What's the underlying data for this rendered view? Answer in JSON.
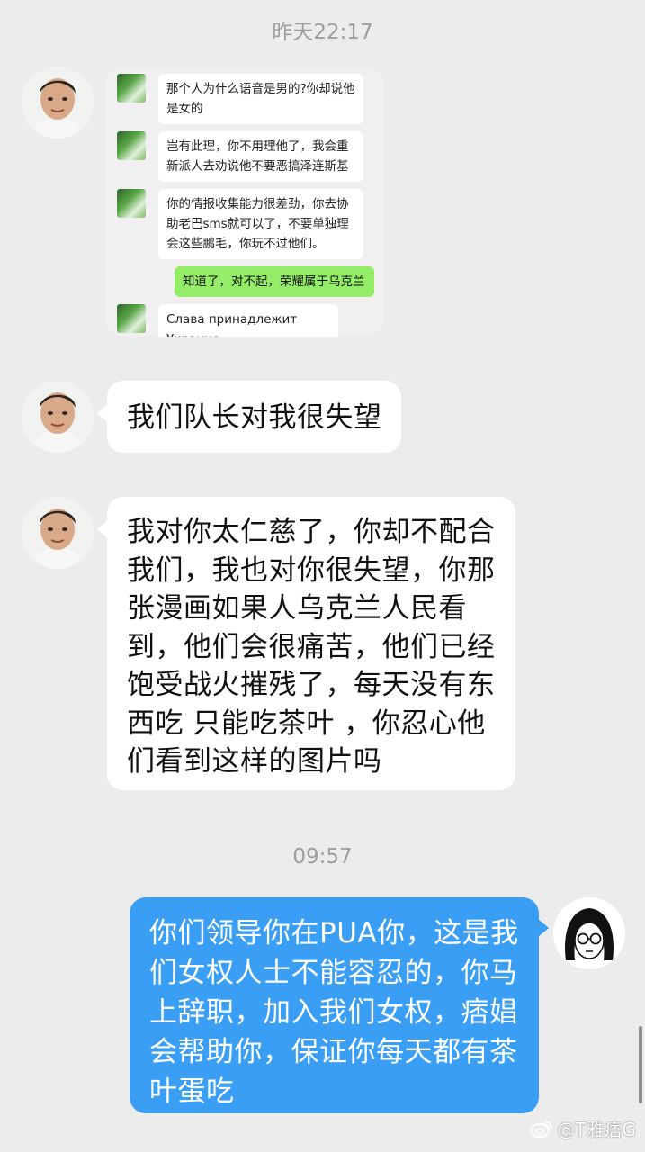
{
  "timestamps": {
    "first": "昨天22:17",
    "second": "09:57"
  },
  "screenshot_card": {
    "messages": [
      {
        "side": "left",
        "text": "那个人为什么语音是男的?你却说他是女的"
      },
      {
        "side": "left",
        "text": "岂有此理，你不用理他了，我会重新派人去劝说他不要恶搞泽连斯基"
      },
      {
        "side": "left",
        "text": "你的情报收集能力很差劲，你去协助老巴sms就可以了，不要单独理会这些鹏毛，你玩不过他们。"
      },
      {
        "side": "right",
        "text": "知道了，对不起，荣耀属于乌克兰"
      },
      {
        "side": "left",
        "text": "Слава принадлежит Украине"
      }
    ]
  },
  "messages": [
    {
      "side": "left",
      "text": "我们队长对我很失望"
    },
    {
      "side": "left",
      "text": "我对你太仁慈了，你却不配合我们，我也对你很失望，你那张漫画如果人乌克兰人民看到，他们会很痛苦，他们已经饱受战火摧残了，每天没有东西吃 只能吃茶叶 ，你忍心他们看到这样的图片吗"
    },
    {
      "side": "right",
      "text": "你们领导你在PUA你，这是我们女权人士不能容忍的，你马上辞职，加入我们女权，痞娼会帮助你，保证你每天都有茶叶蛋吃"
    }
  ],
  "watermark": {
    "text": "@T雅痞G",
    "icon": "weibo-icon"
  },
  "colors": {
    "background": "#ececec",
    "incoming_bubble": "#ffffff",
    "outgoing_bubble": "#3a9ef5",
    "wechat_green": "#95ec69"
  }
}
